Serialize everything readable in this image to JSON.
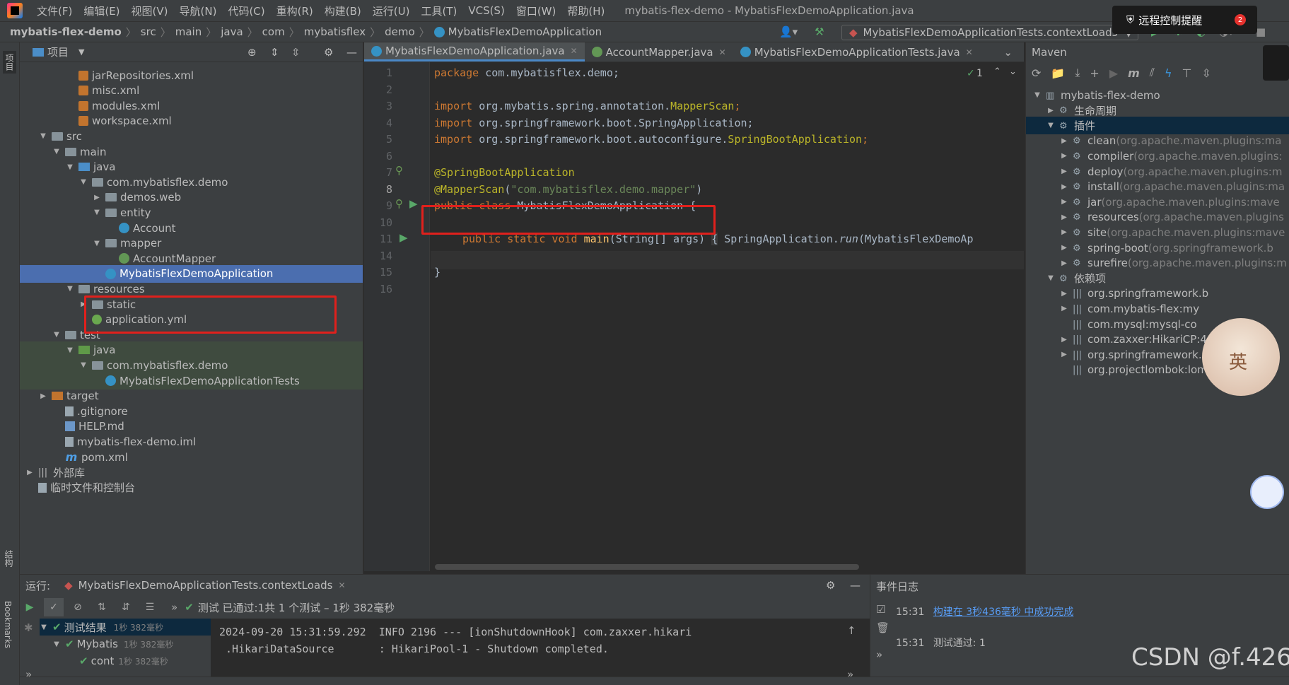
{
  "menu": [
    "文件(F)",
    "编辑(E)",
    "视图(V)",
    "导航(N)",
    "代码(C)",
    "重构(R)",
    "构建(B)",
    "运行(U)",
    "工具(T)",
    "VCS(S)",
    "窗口(W)",
    "帮助(H)"
  ],
  "window_title": "mybatis-flex-demo - MybatisFlexDemoApplication.java",
  "notification": {
    "text": "远程控制提醒",
    "count": "2"
  },
  "breadcrumb": [
    "mybatis-flex-demo",
    "src",
    "main",
    "java",
    "com",
    "mybatisflex",
    "demo",
    "MybatisFlexDemoApplication"
  ],
  "run_config": "MybatisFlexDemoApplicationTests.contextLoads",
  "left_strip": {
    "project": "项目",
    "structure": "结构",
    "bookmarks": "Bookmarks"
  },
  "project_panel": {
    "title": "项目"
  },
  "tree": [
    {
      "label": "jarRepositories.xml",
      "icon": "xml-icon",
      "depth": 3,
      "arrow": ""
    },
    {
      "label": "misc.xml",
      "icon": "xml-icon",
      "depth": 3,
      "arrow": ""
    },
    {
      "label": "modules.xml",
      "icon": "xml-icon",
      "depth": 3,
      "arrow": ""
    },
    {
      "label": "workspace.xml",
      "icon": "xml-icon",
      "depth": 3,
      "arrow": ""
    },
    {
      "label": "src",
      "icon": "folder-icon",
      "depth": 1,
      "arrow": "▼"
    },
    {
      "label": "main",
      "icon": "folder-icon",
      "depth": 2,
      "arrow": "▼"
    },
    {
      "label": "java",
      "icon": "folder-blue-icon",
      "depth": 3,
      "arrow": "▼"
    },
    {
      "label": "com.mybatisflex.demo",
      "icon": "package-icon",
      "depth": 4,
      "arrow": "▼"
    },
    {
      "label": "demos.web",
      "icon": "package-icon",
      "depth": 5,
      "arrow": "▶"
    },
    {
      "label": "entity",
      "icon": "package-icon",
      "depth": 5,
      "arrow": "▼"
    },
    {
      "label": "Account",
      "icon": "class-icon",
      "depth": 6,
      "arrow": ""
    },
    {
      "label": "mapper",
      "icon": "package-icon",
      "depth": 5,
      "arrow": "▼"
    },
    {
      "label": "AccountMapper",
      "icon": "interface-icon",
      "depth": 6,
      "arrow": ""
    },
    {
      "label": "MybatisFlexDemoApplication",
      "icon": "spring-class-icon",
      "depth": 5,
      "arrow": "",
      "selected": true
    },
    {
      "label": "resources",
      "icon": "folder-res-icon",
      "depth": 3,
      "arrow": "▼"
    },
    {
      "label": "static",
      "icon": "folder-icon",
      "depth": 4,
      "arrow": "▶"
    },
    {
      "label": "application.yml",
      "icon": "yml-icon",
      "depth": 4,
      "arrow": ""
    },
    {
      "label": "test",
      "icon": "folder-icon",
      "depth": 2,
      "arrow": "▼"
    },
    {
      "label": "java",
      "icon": "folder-green-icon",
      "depth": 3,
      "arrow": "▼",
      "test": true
    },
    {
      "label": "com.mybatisflex.demo",
      "icon": "package-icon",
      "depth": 4,
      "arrow": "▼",
      "test": true
    },
    {
      "label": "MybatisFlexDemoApplicationTests",
      "icon": "spring-class-icon",
      "depth": 5,
      "arrow": "",
      "test": true
    },
    {
      "label": "target",
      "icon": "folder-orange-icon",
      "depth": 1,
      "arrow": "▶"
    },
    {
      "label": ".gitignore",
      "icon": "file-icon",
      "depth": 2,
      "arrow": ""
    },
    {
      "label": "HELP.md",
      "icon": "md-icon",
      "depth": 2,
      "arrow": ""
    },
    {
      "label": "mybatis-flex-demo.iml",
      "icon": "file-icon",
      "depth": 2,
      "arrow": ""
    },
    {
      "label": "pom.xml",
      "icon": "maven-icon",
      "depth": 2,
      "arrow": ""
    },
    {
      "label": "外部库",
      "icon": "library-icon",
      "depth": 0,
      "arrow": "▶"
    },
    {
      "label": "临时文件和控制台",
      "icon": "scratch-icon",
      "depth": 0,
      "arrow": ""
    }
  ],
  "tabs": [
    {
      "label": "MybatisFlexDemoApplication.java",
      "active": true
    },
    {
      "label": "AccountMapper.java",
      "active": false
    },
    {
      "label": "MybatisFlexDemoApplicationTests.java",
      "active": false
    }
  ],
  "editor": {
    "inspection_count": "1",
    "line_numbers": [
      "1",
      "2",
      "3",
      "4",
      "5",
      "6",
      "7",
      "8",
      "9",
      "10",
      "11",
      "14",
      "15",
      "16"
    ],
    "lines": {
      "l1": [
        "package",
        " com.mybatisflex.demo;"
      ],
      "l3": [
        "import",
        " org.mybatis.spring.annotation.",
        "MapperScan",
        ";"
      ],
      "l4": [
        "import",
        " org.springframework.boot.SpringApplication;"
      ],
      "l5": [
        "import",
        " org.springframework.boot.autoconfigure.",
        "SpringBootApplication",
        ";"
      ],
      "l7": "@SpringBootApplication",
      "l8": [
        "@MapperScan",
        "(",
        "\"com.mybatisflex.demo.mapper\"",
        ")"
      ],
      "l9": [
        "public class",
        " MybatisFlexDemoApplication {"
      ],
      "l11": [
        "public static void",
        " ",
        "main",
        "(String[] args) ",
        "{",
        " SpringApplication.",
        "run",
        "(MybatisFlexDemoAp"
      ],
      "l15": "}"
    }
  },
  "maven": {
    "title": "Maven",
    "rows": [
      {
        "label": "mybatis-flex-demo",
        "extra": "",
        "depth": 0,
        "arrow": "▼"
      },
      {
        "label": "生命周期",
        "extra": "",
        "depth": 1,
        "arrow": "▶"
      },
      {
        "label": "插件",
        "extra": "",
        "depth": 1,
        "arrow": "▼",
        "selected": true
      },
      {
        "label": "clean",
        "extra": " (org.apache.maven.plugins:ma",
        "depth": 2,
        "arrow": "▶"
      },
      {
        "label": "compiler",
        "extra": " (org.apache.maven.plugins:",
        "depth": 2,
        "arrow": "▶"
      },
      {
        "label": "deploy",
        "extra": " (org.apache.maven.plugins:m",
        "depth": 2,
        "arrow": "▶"
      },
      {
        "label": "install",
        "extra": " (org.apache.maven.plugins:ma",
        "depth": 2,
        "arrow": "▶"
      },
      {
        "label": "jar",
        "extra": " (org.apache.maven.plugins:mave",
        "depth": 2,
        "arrow": "▶"
      },
      {
        "label": "resources",
        "extra": " (org.apache.maven.plugins",
        "depth": 2,
        "arrow": "▶"
      },
      {
        "label": "site",
        "extra": " (org.apache.maven.plugins:mave",
        "depth": 2,
        "arrow": "▶"
      },
      {
        "label": "spring-boot",
        "extra": " (org.springframework.b",
        "depth": 2,
        "arrow": "▶"
      },
      {
        "label": "surefire",
        "extra": " (org.apache.maven.plugins:m",
        "depth": 2,
        "arrow": "▶"
      },
      {
        "label": "依赖项",
        "extra": "",
        "depth": 1,
        "arrow": "▼"
      },
      {
        "label": "org.springframework.b",
        "extra": "",
        "depth": 2,
        "arrow": "▶"
      },
      {
        "label": "com.mybatis-flex:my",
        "extra": "",
        "depth": 2,
        "arrow": "▶"
      },
      {
        "label": "com.mysql:mysql-co",
        "extra": "",
        "depth": 2,
        "arrow": ""
      },
      {
        "label": "com.zaxxer:HikariCP:4",
        "extra": "",
        "depth": 2,
        "arrow": "▶"
      },
      {
        "label": "org.springframework.boot:spring-bo",
        "extra": "",
        "depth": 2,
        "arrow": "▶"
      },
      {
        "label": "org.projectlombok:lombok:1.18.24",
        "extra": "",
        "depth": 2,
        "arrow": ""
      }
    ]
  },
  "run": {
    "label": "运行:",
    "config": "MybatisFlexDemoApplicationTests.contextLoads",
    "status_prefix": "测试 已通过:",
    "status_detail": " 1共 1 个测试 – 1秒 382毫秒",
    "tests": [
      {
        "label": "测试结果",
        "time": "1秒 382毫秒"
      },
      {
        "label": "Mybatis",
        "time": "1秒 382毫秒"
      },
      {
        "label": "cont",
        "time": "1秒 382毫秒"
      }
    ],
    "console": [
      "2024-09-20 15:31:59.292  INFO 2196 --- [ionShutdownHook] com.zaxxer.hikari",
      " .HikariDataSource       : HikariPool-1 - Shutdown completed."
    ]
  },
  "event_log": {
    "title": "事件日志",
    "entries": [
      {
        "time": "15:31",
        "text": "构建在 3秒436毫秒 中成功完成",
        "link": true
      },
      {
        "time": "15:31",
        "text": "测试通过: 1",
        "link": false
      }
    ]
  },
  "watermark": "CSDN @f.426",
  "mascot_char": "英"
}
